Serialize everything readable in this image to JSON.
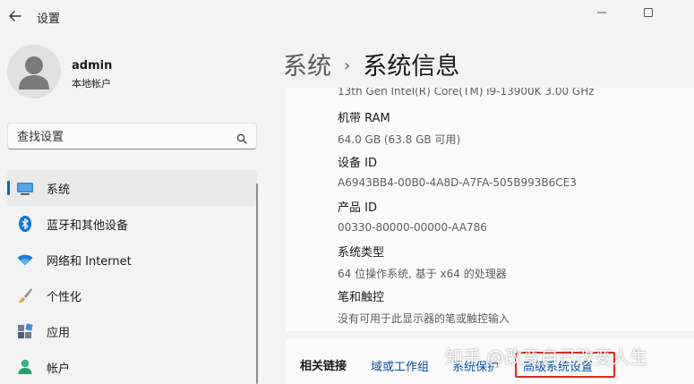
{
  "app": {
    "title": "设置",
    "back_icon": "arrow-left-icon",
    "window_controls": [
      "minimize-icon",
      "maximize-icon"
    ]
  },
  "user": {
    "name": "admin",
    "account_type": "本地帐户",
    "avatar_icon": "person-icon"
  },
  "search": {
    "placeholder": "查找设置",
    "icon": "search-icon"
  },
  "nav": {
    "items": [
      {
        "label": "系统",
        "icon": "monitor-icon",
        "active": true
      },
      {
        "label": "蓝牙和其他设备",
        "icon": "bluetooth-icon",
        "active": false
      },
      {
        "label": "网络和 Internet",
        "icon": "wifi-icon",
        "active": false
      },
      {
        "label": "个性化",
        "icon": "brush-icon",
        "active": false
      },
      {
        "label": "应用",
        "icon": "apps-icon",
        "active": false
      },
      {
        "label": "帐户",
        "icon": "account-icon",
        "active": false
      }
    ]
  },
  "breadcrumb": {
    "parent": "系统",
    "separator": "›",
    "current": "系统信息"
  },
  "specs": {
    "processor_value": "13th Gen Intel(R) Core(TM) i9-13900K   3.00 GHz",
    "items": [
      {
        "label": "机带 RAM",
        "value": "64.0 GB (63.8 GB 可用)"
      },
      {
        "label": "设备 ID",
        "value": "A6943BB4-00B0-4A8D-A7FA-505B993B6CE3"
      },
      {
        "label": "产品 ID",
        "value": "00330-80000-00000-AA786"
      },
      {
        "label": "系统类型",
        "value": "64 位操作系统, 基于 x64 的处理器"
      },
      {
        "label": "笔和触控",
        "value": "没有可用于此显示器的笔或触控输入"
      }
    ]
  },
  "related": {
    "title": "相关链接",
    "links": [
      "域或工作组",
      "系统保护",
      "高级系统设置"
    ],
    "highlight_color": "#e0281c"
  },
  "watermark": "知乎 @改变自己改变人生",
  "colors": {
    "accent": "#0067c0",
    "link": "#0050a8",
    "background": "#f3f3f3"
  }
}
